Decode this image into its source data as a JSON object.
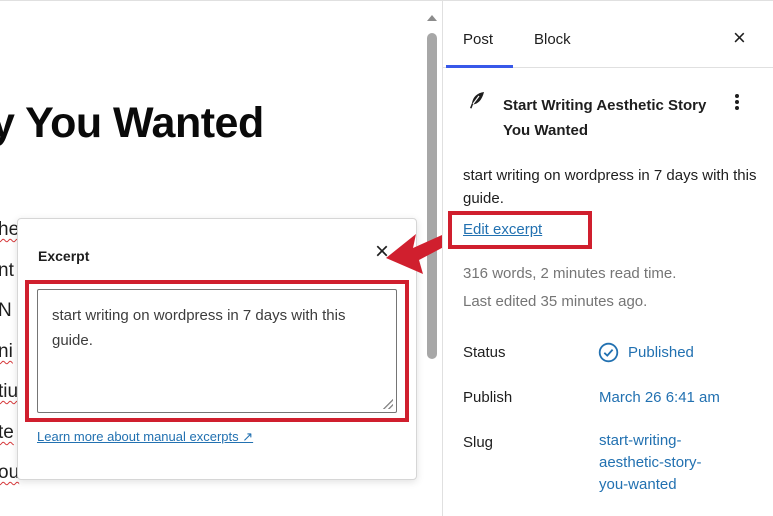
{
  "editor": {
    "post_title": "y You Wanted",
    "body_fragments": [
      "he",
      "nt",
      "N",
      "ni",
      "tiu",
      "te",
      "ou"
    ]
  },
  "excerpt_popover": {
    "title": "Excerpt",
    "close": "×",
    "excerpt_value": "start writing on wordpress in 7 days with this guide.",
    "learn_more_link": "Learn more about manual excerpts ↗"
  },
  "sidebar": {
    "tabs": [
      {
        "label": "Post",
        "active": true
      },
      {
        "label": "Block",
        "active": false
      }
    ],
    "close": "×",
    "post_title": "Start Writing Aesthetic Story You Wanted",
    "excerpt": "start writing on wordpress in 7 days with this guide.",
    "edit_excerpt_link": "Edit excerpt",
    "word_stats": "316 words, 2 minutes read time.",
    "last_edited": "Last edited 35 minutes ago.",
    "rows": {
      "status": {
        "label": "Status",
        "value": "Published"
      },
      "publish": {
        "label": "Publish",
        "value": "March 26 6:41 am"
      },
      "slug": {
        "label": "Slug",
        "value": "start-writing-aesthetic-story-you-wanted"
      }
    }
  },
  "colors": {
    "accent": "#3858e9",
    "link": "#2271b1",
    "highlight": "#d01f2e"
  },
  "icons": [
    "feather-icon",
    "kebab-menu-icon",
    "close-icon",
    "check-circle-icon",
    "external-link-icon",
    "arrow-annotation-icon"
  ]
}
